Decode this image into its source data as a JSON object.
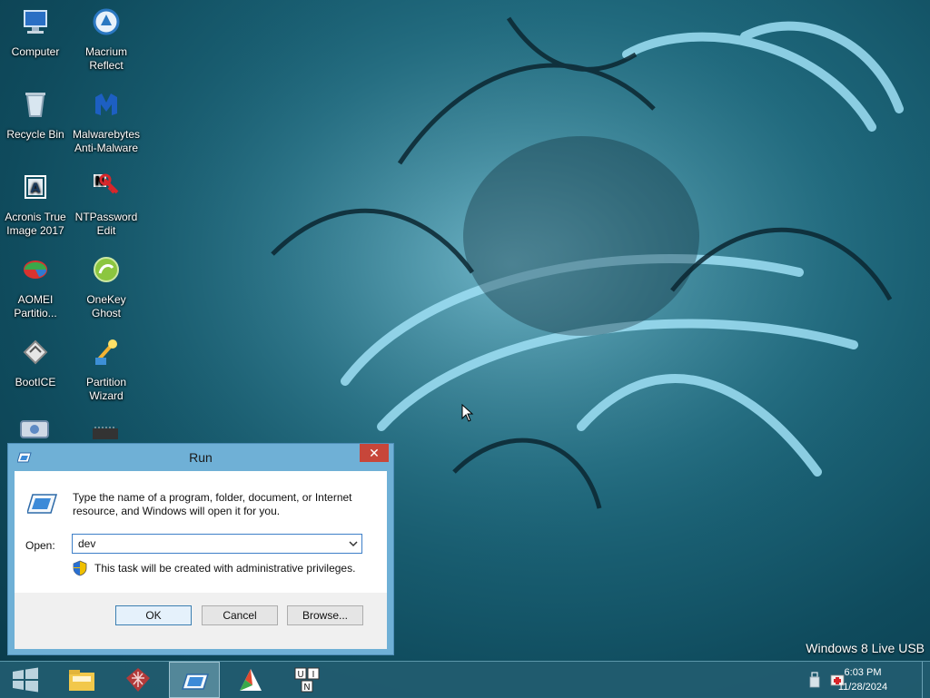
{
  "desktop": {
    "icons": [
      {
        "label": "Computer",
        "icon": "computer-icon"
      },
      {
        "label": "Macrium Reflect",
        "icon": "macrium-reflect-icon"
      },
      {
        "label": "Recycle Bin",
        "icon": "recycle-bin-icon"
      },
      {
        "label": "Malwarebytes Anti-Malware",
        "icon": "malwarebytes-icon"
      },
      {
        "label": "Acronis True Image 2017",
        "icon": "acronis-icon"
      },
      {
        "label": "NTPassword Edit",
        "icon": "ntpassword-icon"
      },
      {
        "label": "AOMEI Partitio...",
        "icon": "aomei-icon"
      },
      {
        "label": "OneKey Ghost",
        "icon": "onekey-ghost-icon"
      },
      {
        "label": "BootICE",
        "icon": "bootice-icon"
      },
      {
        "label": "Partition Wizard",
        "icon": "partition-wizard-icon"
      }
    ],
    "watermark": "Windows 8 Live USB"
  },
  "run_dialog": {
    "title": "Run",
    "close_glyph": "✕",
    "description": "Type the name of a program, folder, document, or Internet resource, and Windows will open it for you.",
    "open_label": "Open:",
    "open_value": "dev",
    "admin_note": "This task will be created with administrative privileges.",
    "ok_label": "OK",
    "cancel_label": "Cancel",
    "browse_label": "Browse..."
  },
  "taskbar": {
    "buttons": [
      {
        "icon": "start-windows-icon",
        "active": false
      },
      {
        "icon": "file-explorer-icon",
        "active": false
      },
      {
        "icon": "network-grid-icon",
        "active": false
      },
      {
        "icon": "run-dialog-icon",
        "active": true
      },
      {
        "icon": "partition-tool-icon",
        "active": false
      },
      {
        "icon": "uin-app-icon",
        "active": false
      }
    ],
    "time": "6:03 PM",
    "date": "11/28/2024"
  }
}
